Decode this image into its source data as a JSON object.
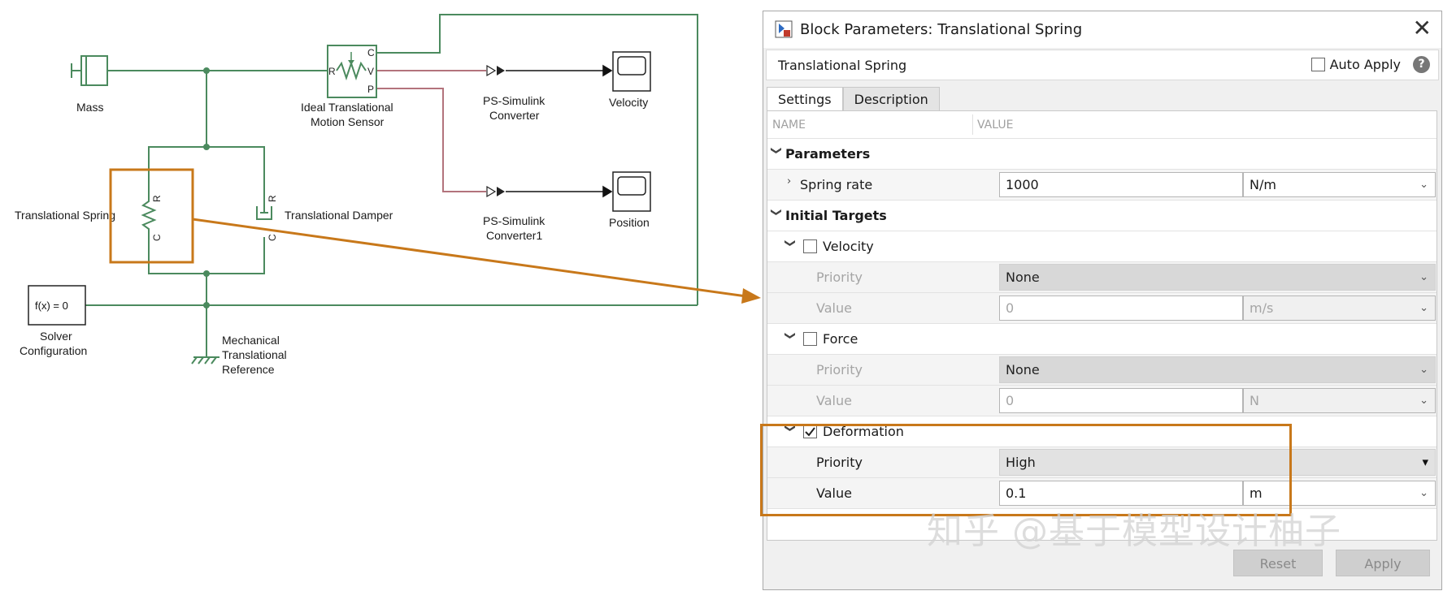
{
  "diagram": {
    "blocks": {
      "mass": "Mass",
      "sensor_line1": "Ideal Translational",
      "sensor_line2": "Motion Sensor",
      "ps1_line1": "PS-Simulink",
      "ps1_line2": "Converter",
      "ps2_line1": "PS-Simulink",
      "ps2_line2": "Converter1",
      "velocity_scope": "Velocity",
      "position_scope": "Position",
      "spring": "Translational Spring",
      "damper": "Translational Damper",
      "solver_block": "f(x) = 0",
      "solver_line1": "Solver",
      "solver_line2": "Configuration",
      "ref_line1": "Mechanical",
      "ref_line2": "Translational",
      "ref_line3": "Reference"
    },
    "ports": {
      "r": "R",
      "c": "C",
      "v": "V",
      "p": "P"
    },
    "colors": {
      "wire": "#4b8a5e",
      "signal": "#b3737c",
      "highlight": "#c8781a"
    }
  },
  "dialog": {
    "title": "Block Parameters: Translational Spring",
    "block_name": "Translational Spring",
    "auto_apply": "Auto Apply",
    "help": "?",
    "close": "✕",
    "tabs": [
      "Settings",
      "Description"
    ],
    "columns": {
      "name": "NAME",
      "value": "VALUE"
    },
    "parameters": {
      "heading": "Parameters",
      "spring_rate": {
        "label": "Spring rate",
        "value": "1000",
        "unit": "N/m"
      }
    },
    "initial_targets": {
      "heading": "Initial Targets",
      "velocity": {
        "label": "Velocity",
        "checked": false,
        "priority_label": "Priority",
        "priority": "None",
        "value_label": "Value",
        "value": "0",
        "unit": "m/s"
      },
      "force": {
        "label": "Force",
        "checked": false,
        "priority_label": "Priority",
        "priority": "None",
        "value_label": "Value",
        "value": "0",
        "unit": "N"
      },
      "deformation": {
        "label": "Deformation",
        "checked": true,
        "priority_label": "Priority",
        "priority": "High",
        "value_label": "Value",
        "value": "0.1",
        "unit": "m"
      }
    },
    "buttons": {
      "reset": "Reset",
      "apply": "Apply"
    }
  },
  "watermark": "知乎 @基于模型设计柚子"
}
